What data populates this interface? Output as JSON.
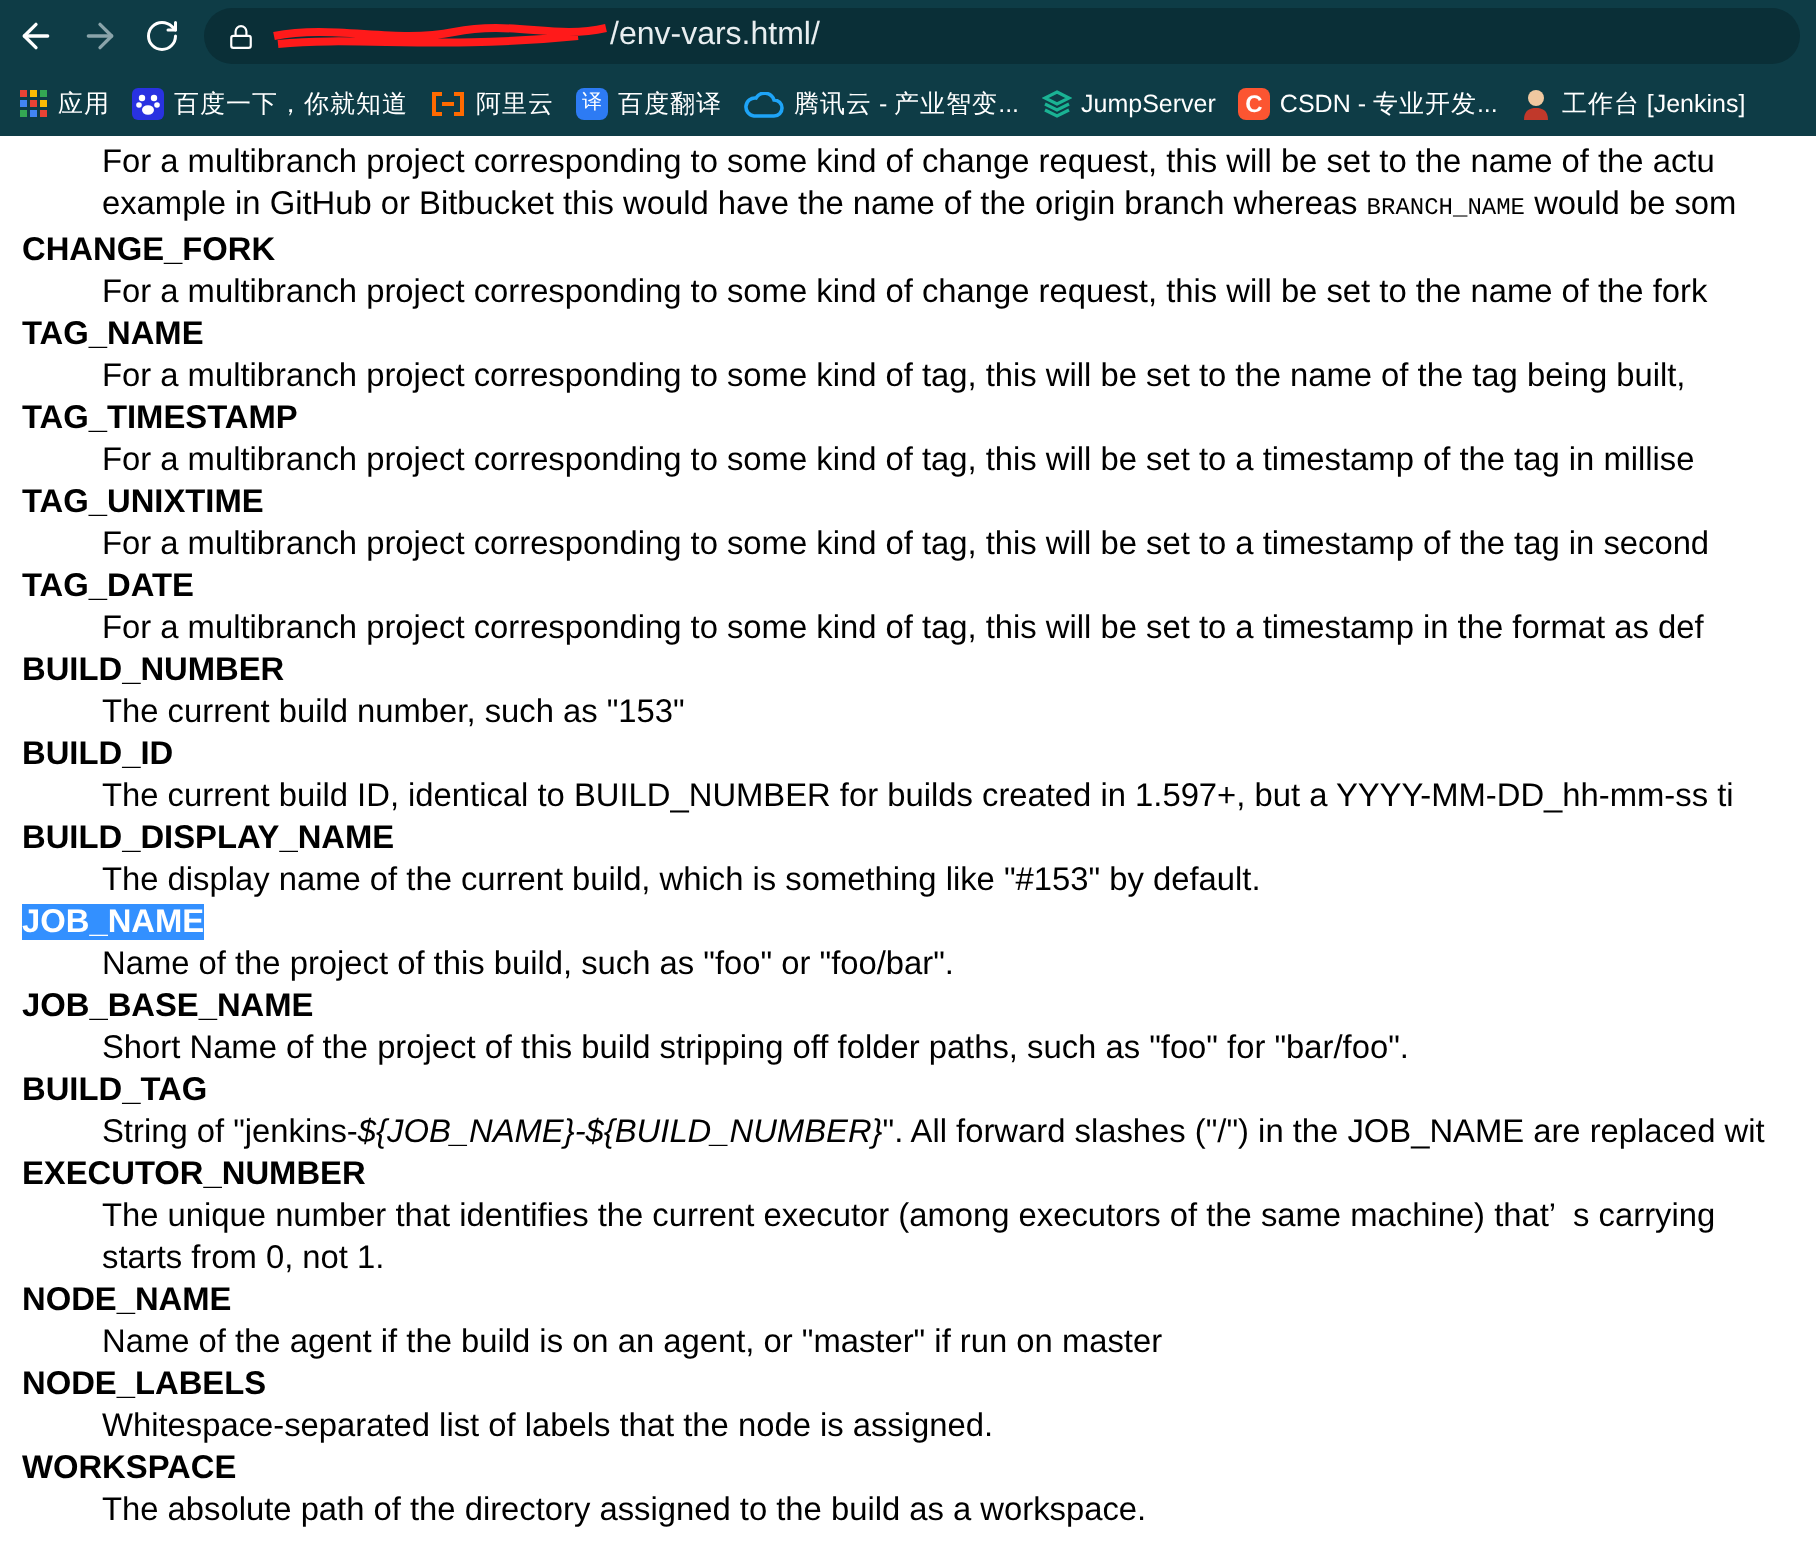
{
  "browser": {
    "url": "/env-vars.html/",
    "bookmarks": [
      {
        "kind": "apps",
        "label": "应用"
      },
      {
        "kind": "paw",
        "label": "百度一下，你就知道"
      },
      {
        "kind": "bracket",
        "label": "阿里云"
      },
      {
        "kind": "badge",
        "badge": "译",
        "label": "百度翻译"
      },
      {
        "kind": "cloud",
        "label": "腾讯云 - 产业智变..."
      },
      {
        "kind": "layers",
        "label": "JumpServer"
      },
      {
        "kind": "badge_red",
        "badge": "C",
        "label": "CSDN - 专业开发..."
      },
      {
        "kind": "person",
        "label": "工作台 [Jenkins]"
      }
    ]
  },
  "continued_description": {
    "line_1": "For a multibranch project corresponding to some kind of change request, this will be set to the name of the actu",
    "line_2": {
      "before": "example in GitHub or Bitbucket this would have the name of the origin branch whereas ",
      "code": "BRANCH_NAME",
      "after": " would be som"
    }
  },
  "entries": [
    {
      "name": "CHANGE_FORK",
      "selected": false,
      "description": [
        "For a multibranch project corresponding to some kind of change request, this will be set to the name of the fork"
      ]
    },
    {
      "name": "TAG_NAME",
      "selected": false,
      "description": [
        "For a multibranch project corresponding to some kind of tag, this will be set to the name of the tag being built,"
      ]
    },
    {
      "name": "TAG_TIMESTAMP",
      "selected": false,
      "description": [
        "For a multibranch project corresponding to some kind of tag, this will be set to a timestamp of the tag in millise"
      ]
    },
    {
      "name": "TAG_UNIXTIME",
      "selected": false,
      "description": [
        "For a multibranch project corresponding to some kind of tag, this will be set to a timestamp of the tag in second"
      ]
    },
    {
      "name": "TAG_DATE",
      "selected": false,
      "description": [
        "For a multibranch project corresponding to some kind of tag, this will be set to a timestamp in the format as def"
      ]
    },
    {
      "name": "BUILD_NUMBER",
      "selected": false,
      "description": [
        "The current build number, such as \"153\""
      ]
    },
    {
      "name": "BUILD_ID",
      "selected": false,
      "description": [
        "The current build ID, identical to BUILD_NUMBER for builds created in 1.597+, but a YYYY-MM-DD_hh-mm-ss ti"
      ]
    },
    {
      "name": "BUILD_DISPLAY_NAME",
      "selected": false,
      "description": [
        "The display name of the current build, which is something like \"#153\" by default."
      ]
    },
    {
      "name": "JOB_NAME",
      "selected": true,
      "description": [
        "Name of the project of this build, such as \"foo\" or \"foo/bar\"."
      ]
    },
    {
      "name": "JOB_BASE_NAME",
      "selected": false,
      "description": [
        "Short Name of the project of this build stripping off folder paths, such as \"foo\" for \"bar/foo\"."
      ]
    },
    {
      "name": "BUILD_TAG",
      "selected": false,
      "description": [
        "String of \"jenkins-*${JOB_NAME}-${BUILD_NUMBER}*\". All forward slashes (\"/\") in the JOB_NAME are replaced wit"
      ]
    },
    {
      "name": "EXECUTOR_NUMBER",
      "selected": false,
      "description": [
        "The unique number that identifies the current executor (among executors of the same machine) that’  s carrying",
        "starts from 0, not 1."
      ]
    },
    {
      "name": "NODE_NAME",
      "selected": false,
      "description": [
        "Name of the agent if the build is on an agent, or \"master\" if run on master"
      ]
    },
    {
      "name": "NODE_LABELS",
      "selected": false,
      "description": [
        "Whitespace-separated list of labels that the node is assigned."
      ]
    },
    {
      "name": "WORKSPACE",
      "selected": false,
      "description": [
        "The absolute path of the directory assigned to the build as a workspace."
      ]
    }
  ]
}
